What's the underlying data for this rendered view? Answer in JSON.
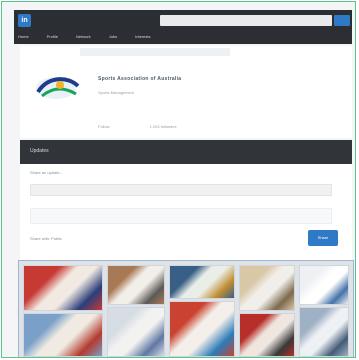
{
  "topnav": {
    "logo_text": "in",
    "search_placeholder": "",
    "links": [
      "Home",
      "Profile",
      "Network",
      "Jobs",
      "Interests"
    ]
  },
  "profile": {
    "org_name": "Sports Association of Australia",
    "org_subtitle": "Sports Management",
    "meta_1": "Follow",
    "meta_2": "1,204 followers"
  },
  "section": {
    "title": "Updates"
  },
  "feed": {
    "label": "Share an update...",
    "meta": "Share with: Public",
    "post_label": "Share"
  },
  "gallery": {
    "photos": [
      {
        "name": "photo-1",
        "colors": [
          "#c73a33",
          "#f1e9e2",
          "#2b3e7a"
        ]
      },
      {
        "name": "photo-2",
        "colors": [
          "#7aa0c9",
          "#f0eae2",
          "#b43a2e"
        ]
      },
      {
        "name": "photo-3",
        "colors": [
          "#a87955",
          "#f2eee9",
          "#5c5a57"
        ]
      },
      {
        "name": "photo-4",
        "colors": [
          "#d7dde4",
          "#f2f2f0",
          "#5f77a3"
        ]
      },
      {
        "name": "photo-5",
        "colors": [
          "#3a5f86",
          "#e9efe8",
          "#c08d33"
        ]
      },
      {
        "name": "photo-6",
        "colors": [
          "#c94330",
          "#f4efea",
          "#2d7ab7"
        ]
      },
      {
        "name": "photo-7",
        "colors": [
          "#d9c7a6",
          "#f1efe9",
          "#7d6a4e"
        ]
      },
      {
        "name": "photo-8",
        "colors": [
          "#b82f2a",
          "#eee6df",
          "#383838"
        ]
      },
      {
        "name": "photo-9",
        "colors": [
          "#eef0f3",
          "#ffffff",
          "#4472a8"
        ]
      },
      {
        "name": "photo-10",
        "colors": [
          "#9fb1c4",
          "#eef1f4",
          "#445b78"
        ]
      }
    ]
  },
  "colors": {
    "brand_blue": "#2f7ac7",
    "nav_dark": "#2b2f33",
    "frame_green": "#5cc38a"
  }
}
